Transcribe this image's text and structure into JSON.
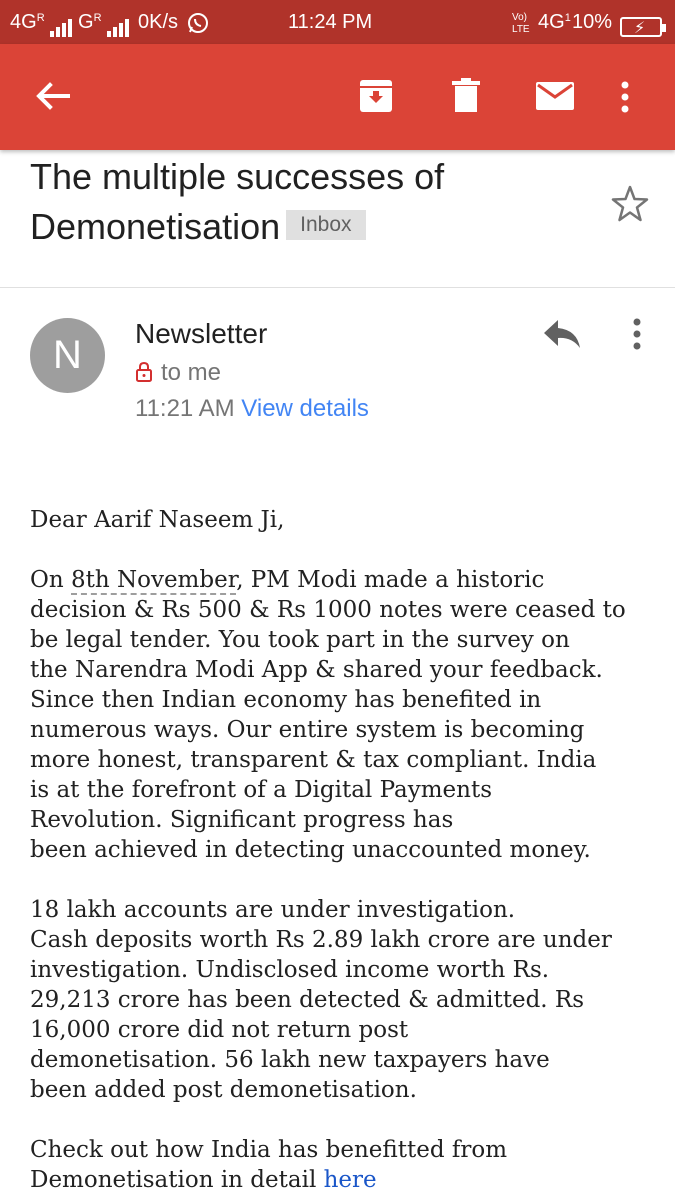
{
  "status_bar": {
    "net1": "4G",
    "net1_sup": "R",
    "net2": "G",
    "net2_sup": "R",
    "speed": "0K/s",
    "time": "11:24 PM",
    "volte": "Vo) LTE",
    "net3": "4G",
    "net3_sup": "1",
    "battery_pct": "10%"
  },
  "toolbar": {
    "back_icon": "arrow-back-icon",
    "archive_icon": "archive-icon",
    "delete_icon": "trash-icon",
    "mark_unread_icon": "mail-icon",
    "overflow_icon": "more-vert-icon",
    "color": "#db4437"
  },
  "email": {
    "subject_line1": "The multiple successes of",
    "subject_line2": "Demonetisation",
    "label": "Inbox",
    "sender_initial": "N",
    "sender_name": "Newsletter",
    "recipient": "to me",
    "time": "11:21 AM",
    "view_details": "View details"
  },
  "body": {
    "greeting": "Dear Aarif Naseem Ji,",
    "p1": [
      "On 8th November, PM Modi made a historic",
      "decision & Rs 500 & Rs 1000 notes were ceased to",
      "be legal tender. You took part in the survey on",
      "the Narendra Modi App & shared your feedback.",
      "Since then Indian economy has benefited in",
      "numerous ways. Our entire system is becoming",
      "more honest, transparent & tax compliant. India",
      "is at the forefront of a Digital Payments",
      "Revolution. Significant progress has",
      "been achieved in detecting unaccounted money."
    ],
    "p1_prefix": "On ",
    "p1_date": "8th November",
    "p1_rest": ", PM Modi made a historic",
    "p2": [
      "18 lakh accounts are under investigation.",
      "Cash deposits worth Rs 2.89 lakh crore are under",
      "investigation. Undisclosed income worth Rs.",
      "29,213 crore has been detected & admitted. Rs",
      "16,000 crore did not return post",
      "demonetisation. 56 lakh new taxpayers have",
      "been added post demonetisation."
    ],
    "p3_line1": "Check out how India has benefitted from",
    "p3_line2": "Demonetisation in detail ",
    "p3_link": "here"
  }
}
